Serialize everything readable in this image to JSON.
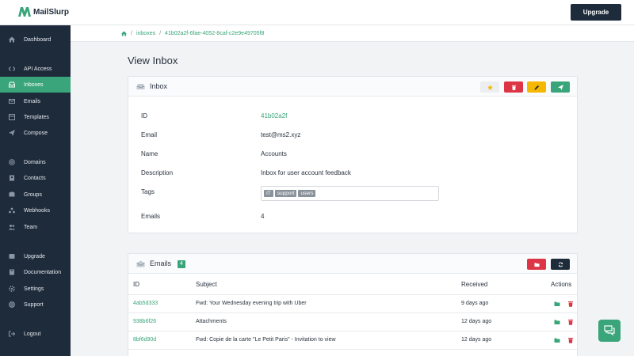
{
  "app": {
    "name": "MailSlurp",
    "upgrade_label": "Upgrade"
  },
  "colors": {
    "brand": "#3aa57a",
    "sidebar": "#1e2b3a",
    "danger": "#dc3545",
    "warning": "#f5b800",
    "star": "#f5b800"
  },
  "sidebar": {
    "items": [
      {
        "label": "Dashboard",
        "icon": "home-icon"
      },
      {
        "label": "API Access",
        "icon": "code-icon"
      },
      {
        "label": "Inboxes",
        "icon": "inbox-icon",
        "active": true
      },
      {
        "label": "Emails",
        "icon": "envelope-icon"
      },
      {
        "label": "Templates",
        "icon": "template-icon"
      },
      {
        "label": "Compose",
        "icon": "send-icon"
      },
      {
        "label": "Domains",
        "icon": "at-icon"
      },
      {
        "label": "Contacts",
        "icon": "address-book-icon"
      },
      {
        "label": "Groups",
        "icon": "groups-icon"
      },
      {
        "label": "Webhooks",
        "icon": "webhook-icon"
      },
      {
        "label": "Team",
        "icon": "team-icon"
      },
      {
        "label": "Upgrade",
        "icon": "upgrade-icon"
      },
      {
        "label": "Documentation",
        "icon": "book-icon"
      },
      {
        "label": "Settings",
        "icon": "gear-icon"
      },
      {
        "label": "Support",
        "icon": "lifebuoy-icon"
      },
      {
        "label": "Logout",
        "icon": "logout-icon"
      }
    ]
  },
  "breadcrumb": {
    "section": "inboxes",
    "current": "41b02a2f-6fae-4052-8caf-c2e9e49705f8"
  },
  "page": {
    "title": "View Inbox"
  },
  "inbox_card": {
    "title": "Inbox",
    "fields": {
      "id_label": "ID",
      "id_value": "41b02a2f",
      "email_label": "Email",
      "email_value": "test@ms2.xyz",
      "name_label": "Name",
      "name_value": "Accounts",
      "description_label": "Description",
      "description_value": "Inbox for user account feedback",
      "tags_label": "Tags",
      "tags": [
        "IT",
        "support",
        "users"
      ],
      "emails_label": "Emails",
      "emails_value": "4"
    }
  },
  "emails_card": {
    "title": "Emails",
    "count": "4",
    "columns": {
      "id": "ID",
      "subject": "Subject",
      "received": "Received",
      "actions": "Actions"
    },
    "rows": [
      {
        "id": "4ab5d333",
        "subject": "Fwd: Your Wednesday evening trip with Uber",
        "received": "9 days ago"
      },
      {
        "id": "938b6f26",
        "subject": "Attachments",
        "received": "12 days ago"
      },
      {
        "id": "8bf6d90d",
        "subject": "Fwd: Copie de la carte \"Le Petit Paris\" - Invitation to view",
        "received": "12 days ago"
      }
    ]
  }
}
